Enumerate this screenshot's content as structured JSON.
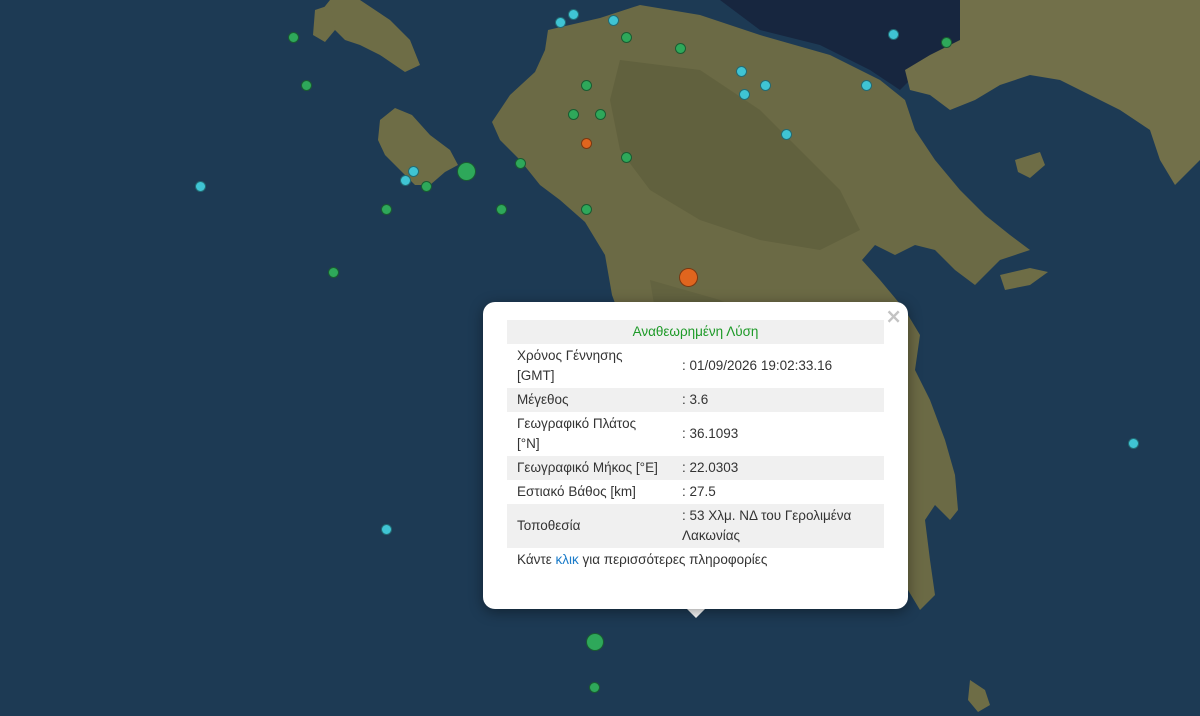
{
  "popup": {
    "header": "Αναθεωρημένη Λύση",
    "close_label": "×",
    "rows": [
      {
        "key": "Χρόνος Γέννησης [GMT]",
        "value": ": 01/09/2026 19:02:33.16"
      },
      {
        "key": "Μέγεθος",
        "value": ": 3.6"
      },
      {
        "key": "Γεωγραφικό Πλάτος [°N]",
        "value": ": 36.1093"
      },
      {
        "key": "Γεωγραφικό Μήκος [°E]",
        "value": ": 22.0303"
      },
      {
        "key": "Εστιακό Βάθος [km]",
        "value": ": 27.5"
      },
      {
        "key": "Τοποθεσία",
        "value": ": 53 Χλμ. ΝΔ του Γερολιμένα Λακωνίας"
      }
    ],
    "footer_prefix": "Κάντε ",
    "footer_link": "κλικ",
    "footer_suffix": " για περισσότερες πληροφορίες"
  },
  "colors": {
    "sea": "#1d3a54",
    "land": "#6b6a45",
    "green_marker": "#2ea85a",
    "cyan_marker": "#3fc4d4",
    "orange_marker": "#e0651e",
    "popup_header_text": "#1e9a28",
    "link": "#1a7bc9"
  },
  "markers": [
    {
      "type": "green",
      "size": "large",
      "lat": 36.1093,
      "lon": 22.0303,
      "selected": true
    },
    {
      "type": "green",
      "size": "small",
      "lat": 35.95,
      "lon": 22.03
    },
    {
      "type": "green",
      "size": "large",
      "lat": 37.75,
      "lon": 21.55
    },
    {
      "type": "green",
      "size": "small",
      "lat": 37.78,
      "lon": 21.75
    },
    {
      "type": "green",
      "size": "small",
      "lat": 37.95,
      "lon": 21.95
    },
    {
      "type": "green",
      "size": "small",
      "lat": 37.95,
      "lon": 22.05
    },
    {
      "type": "green",
      "size": "small",
      "lat": 37.8,
      "lon": 22.15
    },
    {
      "type": "green",
      "size": "small",
      "lat": 37.62,
      "lon": 22.0
    },
    {
      "type": "green",
      "size": "small",
      "lat": 37.62,
      "lon": 21.68
    },
    {
      "type": "green",
      "size": "small",
      "lat": 37.62,
      "lon": 21.25
    },
    {
      "type": "green",
      "size": "small",
      "lat": 37.7,
      "lon": 21.4
    },
    {
      "type": "green",
      "size": "small",
      "lat": 37.4,
      "lon": 21.05
    },
    {
      "type": "green",
      "size": "small",
      "lat": 38.22,
      "lon": 20.9
    },
    {
      "type": "green",
      "size": "small",
      "lat": 38.05,
      "lon": 20.95
    },
    {
      "type": "green",
      "size": "small",
      "lat": 38.18,
      "lon": 22.35
    },
    {
      "type": "green",
      "size": "small",
      "lat": 38.22,
      "lon": 22.15
    },
    {
      "type": "green",
      "size": "small",
      "lat": 38.05,
      "lon": 22.0
    },
    {
      "type": "green",
      "size": "small",
      "lat": 38.2,
      "lon": 23.35
    },
    {
      "type": "cyan",
      "size": "small",
      "lat": 37.75,
      "lon": 21.35
    },
    {
      "type": "cyan",
      "size": "small",
      "lat": 37.72,
      "lon": 21.32
    },
    {
      "type": "cyan",
      "size": "small",
      "lat": 37.7,
      "lon": 20.55
    },
    {
      "type": "cyan",
      "size": "small",
      "lat": 38.3,
      "lon": 21.95
    },
    {
      "type": "cyan",
      "size": "small",
      "lat": 38.28,
      "lon": 22.1
    },
    {
      "type": "cyan",
      "size": "small",
      "lat": 38.27,
      "lon": 21.9
    },
    {
      "type": "cyan",
      "size": "small",
      "lat": 38.1,
      "lon": 22.58
    },
    {
      "type": "cyan",
      "size": "small",
      "lat": 38.05,
      "lon": 22.67
    },
    {
      "type": "cyan",
      "size": "small",
      "lat": 38.02,
      "lon": 22.59
    },
    {
      "type": "cyan",
      "size": "small",
      "lat": 37.88,
      "lon": 22.75
    },
    {
      "type": "cyan",
      "size": "small",
      "lat": 38.23,
      "lon": 23.15
    },
    {
      "type": "cyan",
      "size": "small",
      "lat": 38.05,
      "lon": 23.05
    },
    {
      "type": "cyan",
      "size": "small",
      "lat": 36.5,
      "lon": 21.25
    },
    {
      "type": "cyan",
      "size": "small",
      "lat": 36.8,
      "lon": 24.05
    },
    {
      "type": "orange",
      "size": "small",
      "lat": 37.85,
      "lon": 22.0
    },
    {
      "type": "orange",
      "size": "large",
      "lat": 37.38,
      "lon": 22.38
    },
    {
      "type": "orange",
      "size": "small",
      "lat": 37.1,
      "lon": 22.8
    }
  ]
}
